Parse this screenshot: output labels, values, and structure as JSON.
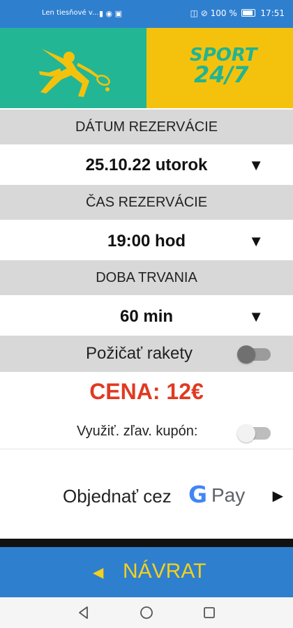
{
  "status_bar": {
    "carrier_text": "Len tiesňové v...",
    "battery_text": "100 %",
    "time": "17:51"
  },
  "banner": {
    "logo_line1": "SPORT",
    "logo_line2": "24/7",
    "colors": {
      "teal": "#22b695",
      "yellow": "#f4c20d"
    },
    "icons": [
      "tennis-player-icon"
    ]
  },
  "reservation": {
    "date_header": "DÁTUM REZERVÁCIE",
    "date_value": "25.10.22 utorok",
    "time_header": "ČAS REZERVÁCIE",
    "time_value": "19:00 hod",
    "duration_header": "DOBA TRVANIA",
    "duration_value": "60 min",
    "dropdown_symbol": "▼"
  },
  "rackets": {
    "label": "Požičať rakety",
    "enabled": false
  },
  "price": {
    "text": "CENA: 12€",
    "color": "#e03a22"
  },
  "coupon": {
    "label": "Využiť. zľav. kupón:",
    "enabled": false
  },
  "gpay": {
    "label": "Objednať cez",
    "g_logo": "G",
    "pay_text": "Pay",
    "arrow": "▶"
  },
  "back": {
    "arrow": "◀",
    "label": "NÁVRAT",
    "color": "#f4d11a",
    "background": "#2f7fcf"
  },
  "navigation_bar": {
    "icons": [
      "back-triangle-icon",
      "home-circle-icon",
      "recents-square-icon"
    ]
  }
}
